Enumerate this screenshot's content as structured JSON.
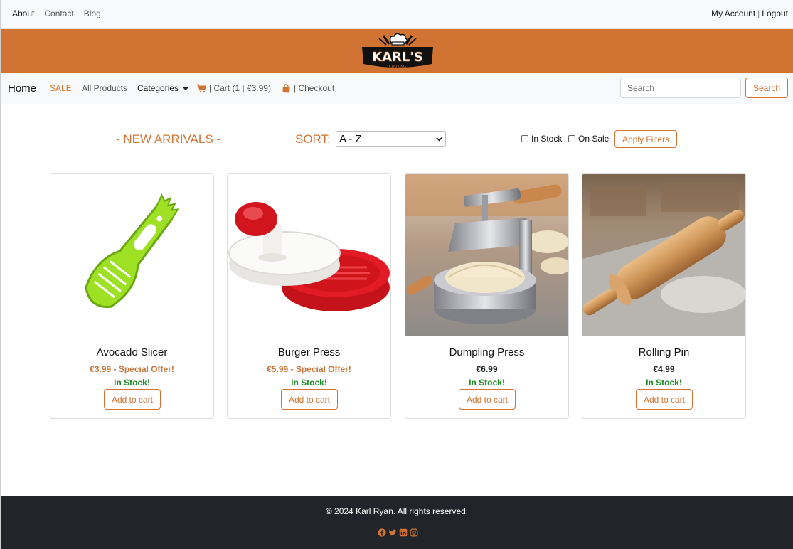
{
  "topbar": {
    "links": [
      "About",
      "Contact",
      "Blog"
    ],
    "account": "My Account",
    "separator": "|",
    "logout": "Logout"
  },
  "brand": {
    "logo_text": "KARL'S",
    "logo_sub": "COOKING",
    "accent_color": "#d17332"
  },
  "nav": {
    "home": "Home",
    "sale": "SALE",
    "all_products": "All Products",
    "categories": "Categories",
    "cart": "| Cart (1 | €3.99)",
    "checkout": "| Checkout",
    "search_placeholder": "Search",
    "search_button": "Search"
  },
  "filters": {
    "heading": "- NEW ARRIVALS -",
    "sort_label": "SORT:",
    "sort_value": "A - Z",
    "in_stock": "In Stock",
    "on_sale": "On Sale",
    "apply": "Apply Filters"
  },
  "products": [
    {
      "name": "Avocado Slicer",
      "price": "€3.99 - Special Offer!",
      "on_sale": true,
      "stock": "In Stock!",
      "button": "Add to cart",
      "image": "avocado-slicer-image"
    },
    {
      "name": "Burger Press",
      "price": "€5.99 - Special Offer!",
      "on_sale": true,
      "stock": "In Stock!",
      "button": "Add to cart",
      "image": "burger-press-image"
    },
    {
      "name": "Dumpling Press",
      "price": "€6.99",
      "on_sale": false,
      "stock": "In Stock!",
      "button": "Add to cart",
      "image": "dumpling-press-image"
    },
    {
      "name": "Rolling Pin",
      "price": "€4.99",
      "on_sale": false,
      "stock": "In Stock!",
      "button": "Add to cart",
      "image": "rolling-pin-image"
    }
  ],
  "footer": {
    "copyright": "© 2024 Karl Ryan. All rights reserved.",
    "social_icons": [
      "facebook-icon",
      "twitter-icon",
      "linkedin-icon",
      "instagram-icon"
    ]
  },
  "colors": {
    "sale_price": "#c8743a",
    "regular_price": "#212529",
    "stock": "#198a1f",
    "footer_bg": "#212529"
  }
}
